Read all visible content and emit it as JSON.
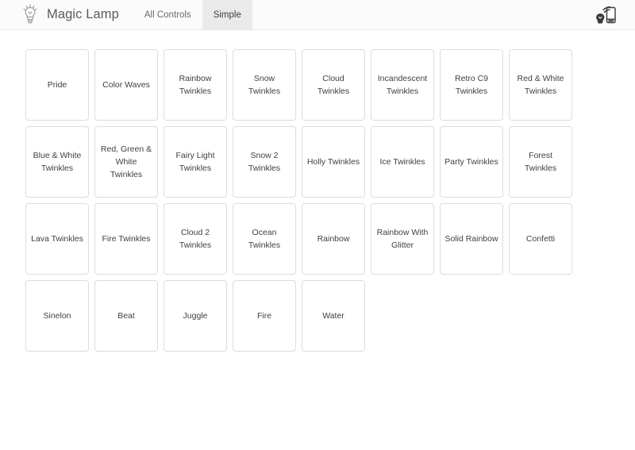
{
  "header": {
    "logo_icon": "genie-lamp-icon",
    "title": "Magic Lamp",
    "tabs": [
      {
        "label": "All Controls",
        "active": false
      },
      {
        "label": "Simple",
        "active": true
      }
    ],
    "actions": [
      {
        "icon": "cast-to-device-icon",
        "label": ""
      }
    ]
  },
  "main": {
    "effects": [
      "Pride",
      "Color Waves",
      "Rainbow Twinkles",
      "Snow Twinkles",
      "Cloud Twinkles",
      "Incandescent Twinkles",
      "Retro C9 Twinkles",
      "Red & White Twinkles",
      "Blue & White Twinkles",
      "Red, Green & White Twinkles",
      "Fairy Light Twinkles",
      "Snow 2 Twinkles",
      "Holly Twinkles",
      "Ice Twinkles",
      "Party Twinkles",
      "Forest Twinkles",
      "Lava Twinkles",
      "Fire Twinkles",
      "Cloud 2 Twinkles",
      "Ocean Twinkles",
      "Rainbow",
      "Rainbow With Glitter",
      "Solid Rainbow",
      "Confetti",
      "Sinelon",
      "Beat",
      "Juggle",
      "Fire",
      "Water"
    ]
  },
  "colors": {
    "page_background": "#ffffff",
    "header_background": "#fbfbfb",
    "header_border": "#e8e8e8",
    "active_tab_background": "#eaeaea",
    "tile_border": "#dddddd",
    "title_text": "#5a5a5a",
    "tile_text": "#3f3f3f"
  }
}
